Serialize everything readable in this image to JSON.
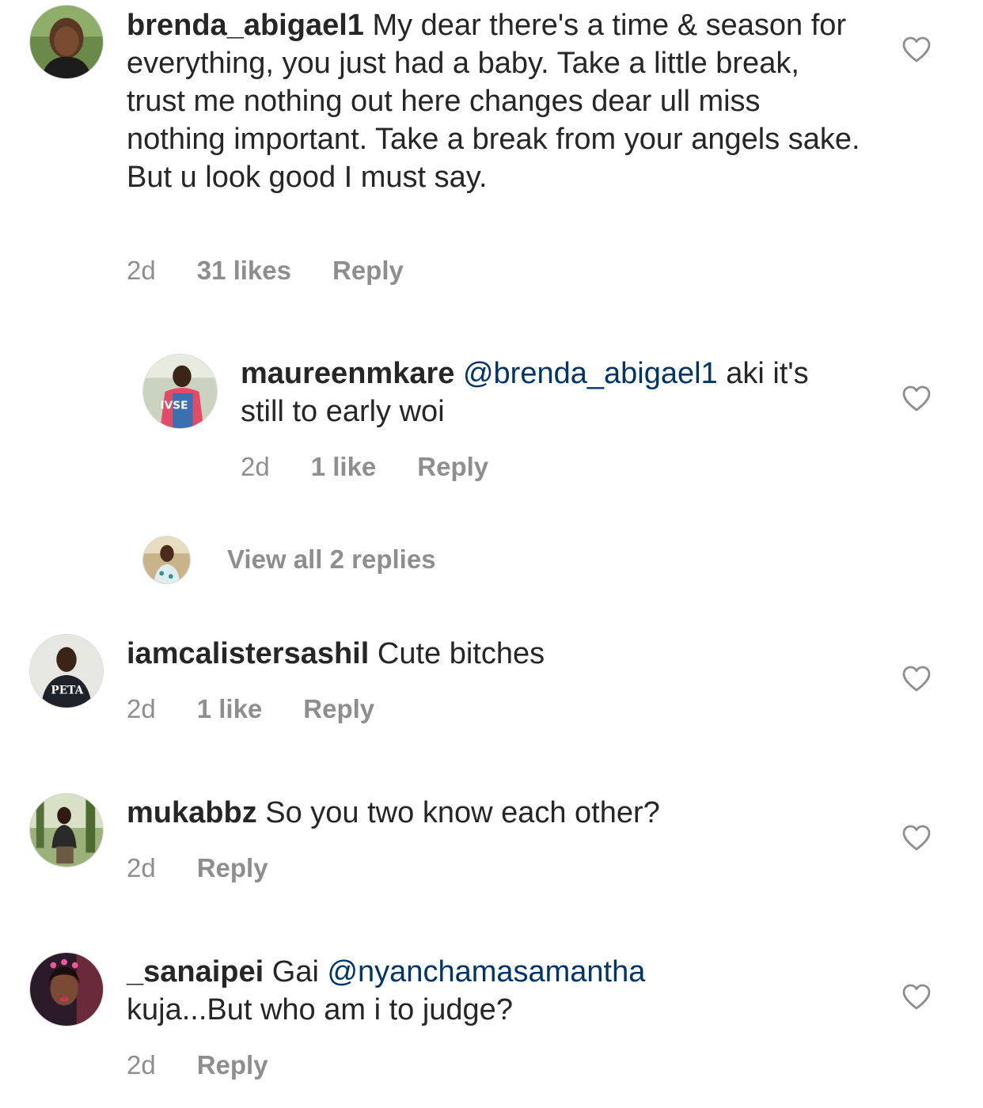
{
  "comments": [
    {
      "username": "brenda_abigael1",
      "text": " My dear there's a time & season for everything, you just had a baby. Take a little break, trust me nothing out here changes dear ull miss nothing important. Take a break from your angels sake. But u look good I must say.",
      "time": "2d",
      "likes": "31 likes",
      "reply": "Reply",
      "avatar_icon": "avatar-photo"
    },
    {
      "username": "maureenmkare",
      "mention": "@brenda_abigael1",
      "text": " aki it's still to early woi",
      "time": "2d",
      "likes": "1 like",
      "reply": "Reply",
      "avatar_icon": "avatar-photo"
    },
    {
      "username": "iamcalistersashil",
      "text": " Cute bitches",
      "time": "2d",
      "likes": "1 like",
      "reply": "Reply",
      "avatar_icon": "avatar-photo"
    },
    {
      "username": "mukabbz",
      "text": " So you two know each other?",
      "time": "2d",
      "reply": "Reply",
      "avatar_icon": "avatar-photo"
    },
    {
      "username": "_sanaipei",
      "text_before": " Gai ",
      "mention": "@nyanchamasamantha",
      "text": " kuja...But who am i to judge?",
      "time": "2d",
      "reply": "Reply",
      "avatar_icon": "avatar-photo"
    }
  ],
  "view_replies": {
    "label": "View all 2 replies"
  },
  "icons": {
    "like": "heart-outline-icon"
  },
  "colors": {
    "text": "#262626",
    "meta": "#8e8e8e",
    "mention": "#003569",
    "background": "#ffffff"
  }
}
